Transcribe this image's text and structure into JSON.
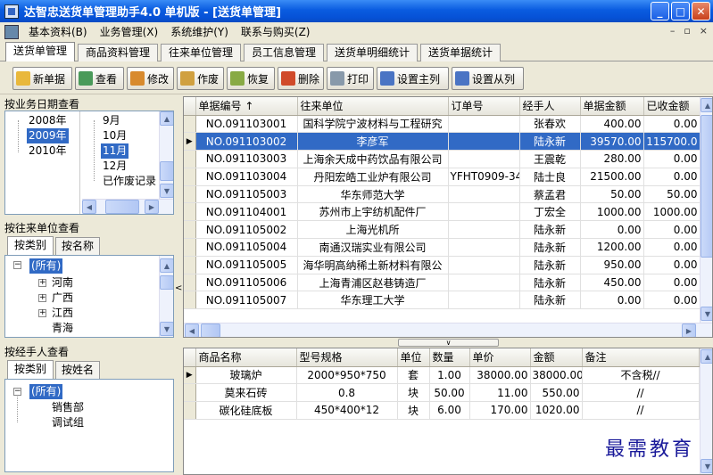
{
  "window": {
    "title": "达智忠送货单管理助手4.0 单机版 - [送货单管理]"
  },
  "menu": {
    "items": [
      "基本资料(B)",
      "业务管理(X)",
      "系统维护(Y)",
      "联系与购买(Z)"
    ],
    "mdi": [
      "–",
      "▫",
      "×"
    ]
  },
  "tabs": [
    "送货单管理",
    "商品资料管理",
    "往来单位管理",
    "员工信息管理",
    "送货单明细统计",
    "送货单据统计"
  ],
  "toolbar": {
    "buttons": [
      {
        "label": "新单据",
        "icon": "new-document-icon",
        "color": "#e9b83c"
      },
      {
        "label": "查看",
        "icon": "view-icon",
        "color": "#4a9a5a"
      },
      {
        "label": "修改",
        "icon": "edit-icon",
        "color": "#d88a2e"
      },
      {
        "label": "作废",
        "icon": "void-icon",
        "color": "#d0a040"
      },
      {
        "label": "恢复",
        "icon": "restore-icon",
        "color": "#88aa44"
      },
      {
        "label": "删除",
        "icon": "delete-icon",
        "color": "#d04a2a"
      },
      {
        "label": "打印",
        "icon": "printer-icon",
        "color": "#8899aa"
      },
      {
        "label": "设置主列",
        "icon": "columns-icon",
        "color": "#4a74c4"
      },
      {
        "label": "设置从列",
        "icon": "columns-icon",
        "color": "#4a74c4"
      }
    ]
  },
  "date_panel": {
    "title": "按业务日期查看",
    "years": [
      "2008年",
      "2009年",
      "2010年"
    ],
    "selected_year": "2009年",
    "months": [
      "9月",
      "10月",
      "11月",
      "12月",
      "已作废记录"
    ],
    "selected_month": "11月"
  },
  "unit_panel": {
    "title": "按往来单位查看",
    "tabs": [
      "按类别",
      "按名称"
    ],
    "root": "(所有)",
    "items": [
      "河南",
      "广西",
      "江西",
      "青海"
    ]
  },
  "handler_panel": {
    "title": "按经手人查看",
    "tabs": [
      "按类别",
      "按姓名"
    ],
    "root": "(所有)",
    "items": [
      "销售部",
      "调试组"
    ]
  },
  "orders": {
    "columns": [
      "单据编号 ↑",
      "往来单位",
      "订单号",
      "经手人",
      "单据金额",
      "已收金额"
    ],
    "selected_index": 1,
    "rows": [
      [
        "NO.091103001",
        "国科学院宁波材料与工程研究",
        "",
        "张春欢",
        "400.00",
        "0.00"
      ],
      [
        "NO.091103002",
        "李彦军",
        "",
        "陆永新",
        "39570.00",
        "115700.0"
      ],
      [
        "NO.091103003",
        "上海余天成中药饮品有限公司",
        "",
        "王震乾",
        "280.00",
        "0.00"
      ],
      [
        "NO.091103004",
        "丹阳宏皓工业炉有限公司",
        "YFHT0909-34",
        "陆士良",
        "21500.00",
        "0.00"
      ],
      [
        "NO.091105003",
        "华东师范大学",
        "",
        "蔡孟君",
        "50.00",
        "50.00"
      ],
      [
        "NO.091104001",
        "苏州市上宇纺机配件厂",
        "",
        "丁宏全",
        "1000.00",
        "1000.00"
      ],
      [
        "NO.091105002",
        "上海光机所",
        "",
        "陆永新",
        "0.00",
        "0.00"
      ],
      [
        "NO.091105004",
        "南通汉瑞实业有限公司",
        "",
        "陆永新",
        "1200.00",
        "0.00"
      ],
      [
        "NO.091105005",
        "海华明高纳稀土新材料有限公",
        "",
        "陆永新",
        "950.00",
        "0.00"
      ],
      [
        "NO.091105006",
        "上海青浦区赵巷铸造厂",
        "",
        "陆永新",
        "450.00",
        "0.00"
      ],
      [
        "NO.091105007",
        "华东理工大学",
        "",
        "陆永新",
        "0.00",
        "0.00"
      ]
    ]
  },
  "details": {
    "columns": [
      "商品名称",
      "型号规格",
      "单位",
      "数量",
      "单价",
      "金额",
      "备注"
    ],
    "rows": [
      [
        "玻璃炉",
        "2000*950*750",
        "套",
        "1.00",
        "38000.00",
        "38000.00",
        "不含税//"
      ],
      [
        "莫来石砖",
        "0.8",
        "块",
        "50.00",
        "11.00",
        "550.00",
        "//"
      ],
      [
        "碳化硅底板",
        "450*400*12",
        "块",
        "6.00",
        "170.00",
        "1020.00",
        "//"
      ]
    ]
  },
  "splitter": {
    "up": "∨",
    "left": "<"
  },
  "watermark": "最需教育"
}
